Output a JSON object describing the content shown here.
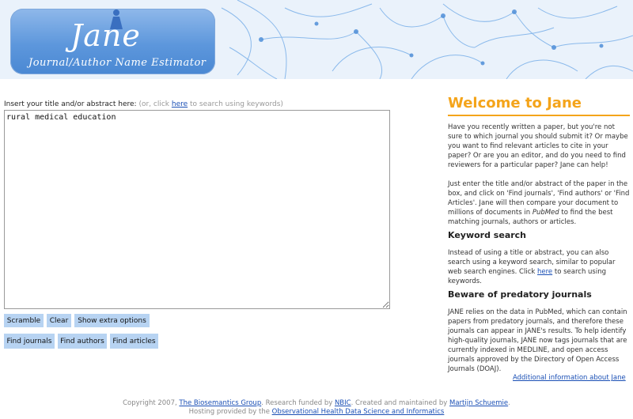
{
  "header": {
    "logo_title": "Jane",
    "logo_subtitle": "Journal/Author Name Estimator",
    "colors": {
      "logo_bg": "#5d97dc",
      "neuron": "#6aa6e6"
    }
  },
  "search": {
    "prompt": "Insert your title and/or abstract here:",
    "hint_prefix": "(or, click ",
    "hint_link": "here",
    "hint_suffix": " to search using keywords)",
    "query_value": "rural medical education"
  },
  "buttons": {
    "scramble": "Scramble",
    "clear": "Clear",
    "show_extra": "Show extra options",
    "find_journals": "Find journals",
    "find_authors": "Find authors",
    "find_articles": "Find articles"
  },
  "sidebar": {
    "title": "Welcome to Jane",
    "intro": "Have you recently written a paper, but you're not sure to which journal you should submit it? Or maybe you want to find relevant articles to cite in your paper? Or are you an editor, and do you need to find reviewers for a particular paper? Jane can help!",
    "howto_prefix": "Just enter the title and/or abstract of the paper in the box, and click on 'Find journals', 'Find authors' or 'Find Articles'. Jane will then compare your document to millions of documents in ",
    "howto_em": "PubMed",
    "howto_suffix": " to find the best matching journals, authors or articles.",
    "keyword_heading": "Keyword search",
    "keyword_prefix": "Instead of using a title or abstract, you can also search using a keyword search, similar to popular web search engines. Click ",
    "keyword_link": "here",
    "keyword_suffix": " to search using keywords.",
    "predatory_heading": "Beware of predatory journals",
    "predatory_text": "JANE relies on the data in PubMed, which can contain papers from predatory journals, and therefore these journals can appear in JANE's results. To help identify high-quality journals, JANE now tags journals that are currently indexed in MEDLINE, and open access journals approved by the Directory of Open Access Journals (DOAJ).",
    "more_info": "Additional information about Jane"
  },
  "footer": {
    "line1_prefix": "Copyright 2007, ",
    "line1_link1": "The Biosemantics Group",
    "line1_mid1": ". Research funded by ",
    "line1_link2": "NBIC",
    "line1_mid2": ". Created and maintained by ",
    "line1_link3": "Martijn Schuemie",
    "line1_end": ".",
    "line2_prefix": "Hosting provided by the ",
    "line2_link": "Observational Health Data Science and Informatics"
  }
}
